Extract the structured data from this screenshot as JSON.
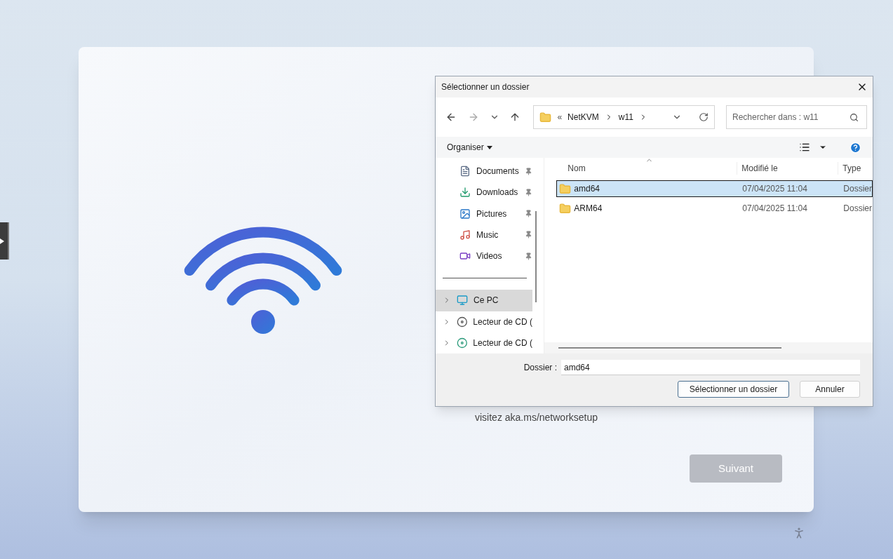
{
  "setup": {
    "hint": "visitez aka.ms/networksetup",
    "next_button": {
      "label": "Suivant",
      "disabled": true
    }
  },
  "dialog": {
    "title": "Sélectionner un dossier",
    "address": {
      "overflow_marker": "«",
      "breadcrumb": [
        "NetKVM",
        "w11"
      ]
    },
    "search": {
      "placeholder": "Rechercher dans : w11"
    },
    "toolbar": {
      "organize": "Organiser"
    },
    "quick_access": [
      {
        "label": "Documents",
        "kind": "documents",
        "pinned": true
      },
      {
        "label": "Downloads",
        "kind": "downloads",
        "pinned": true
      },
      {
        "label": "Pictures",
        "kind": "pictures",
        "pinned": true
      },
      {
        "label": "Music",
        "kind": "music",
        "pinned": true
      },
      {
        "label": "Videos",
        "kind": "videos",
        "pinned": true
      }
    ],
    "locations": [
      {
        "label": "Ce PC",
        "kind": "pc",
        "expandable": true,
        "selected": true
      },
      {
        "label": "Lecteur de CD (",
        "kind": "cd",
        "expandable": true,
        "selected": false
      },
      {
        "label": "Lecteur de CD (",
        "kind": "cd-green",
        "expandable": true,
        "selected": false
      }
    ],
    "columns": [
      "Nom",
      "Modifié le",
      "Type"
    ],
    "rows": [
      {
        "name": "amd64",
        "modified": "07/04/2025 11:04",
        "type": "Dossier",
        "selected": true
      },
      {
        "name": "ARM64",
        "modified": "07/04/2025 11:04",
        "type": "Dossier",
        "selected": false
      }
    ],
    "folder_field": {
      "label": "Dossier :",
      "value": "amd64"
    },
    "buttons": [
      {
        "label": "Sélectionner un dossier",
        "kind": "primary"
      },
      {
        "label": "Annuler",
        "kind": "secondary"
      }
    ]
  }
}
